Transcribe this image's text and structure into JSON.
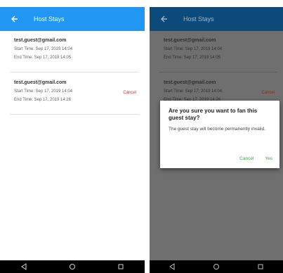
{
  "left": {
    "appbar": {
      "title": "Host Stays"
    },
    "entries": [
      {
        "email": "test.guest@gmail.com",
        "start": "Start Time: Sep 17, 2019 14:04",
        "end": "End Time: Sep 17, 2019 14:05"
      },
      {
        "email": "test.guest@gmail.com",
        "start": "Start Time: Sep 17, 2019 14:04",
        "end": "End Time: Sep 17, 2019 14:26",
        "action": "Cancel"
      }
    ]
  },
  "right": {
    "appbar": {
      "title": "Host Stays"
    },
    "entries": [
      {
        "email": "test.guest@gmail.com",
        "start": "Start Time: Sep 17, 2019 14:04",
        "end": "End Time: Sep 17, 2019 14:05"
      },
      {
        "email": "test.guest@gmail.com",
        "start": "Start Time: Sep 17, 2019 14:04",
        "end": "End Time: Sep 17, 2019 14:26",
        "action": "Cancel"
      }
    ],
    "dialog": {
      "title": "Are you sure you want to fan this guest stay?",
      "message": "The guest stay will become permanently invalid.",
      "cancel_label": "Cancel",
      "confirm_label": "Yes"
    }
  },
  "icons": {
    "back": "back-arrow-icon",
    "nav_back": "nav-back-icon",
    "nav_home": "nav-home-icon",
    "nav_recents": "nav-recents-icon"
  },
  "colors": {
    "primary": "#2196f3",
    "primary_dimmed": "#0c4a7a",
    "accent": "#43a047",
    "danger": "#d32f2f"
  }
}
